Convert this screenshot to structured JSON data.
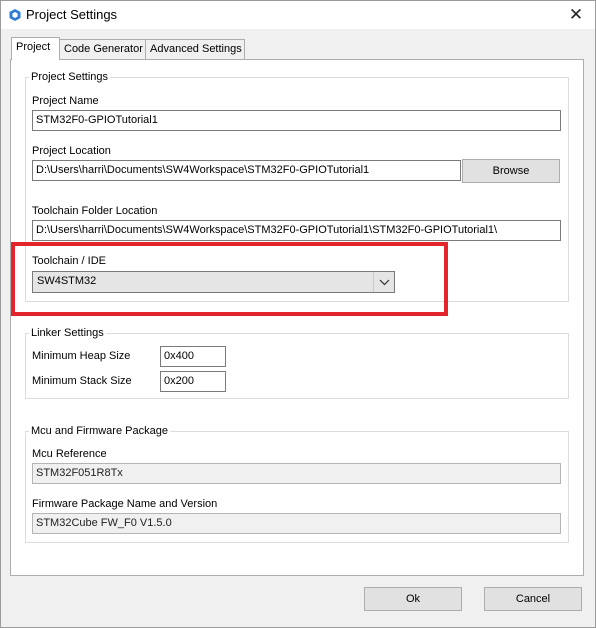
{
  "window": {
    "title": "Project Settings",
    "close_glyph": "✕"
  },
  "tabs": [
    {
      "label": "Project"
    },
    {
      "label": "Code Generator"
    },
    {
      "label": "Advanced Settings"
    }
  ],
  "project_settings": {
    "legend": "Project Settings",
    "project_name": {
      "label": "Project Name",
      "value": "STM32F0-GPIOTutorial1"
    },
    "project_location": {
      "label": "Project Location",
      "value": "D:\\Users\\harri\\Documents\\SW4Workspace\\STM32F0-GPIOTutorial1",
      "browse_label": "Browse"
    },
    "toolchain_folder": {
      "label": "Toolchain Folder Location",
      "value": "D:\\Users\\harri\\Documents\\SW4Workspace\\STM32F0-GPIOTutorial1\\STM32F0-GPIOTutorial1\\"
    },
    "toolchain_ide": {
      "label": "Toolchain / IDE",
      "selected": "SW4STM32"
    }
  },
  "linker_settings": {
    "legend": "Linker Settings",
    "heap": {
      "label": "Minimum Heap Size",
      "value": "0x400"
    },
    "stack": {
      "label": "Minimum Stack Size",
      "value": "0x200"
    }
  },
  "mcu_package": {
    "legend": "Mcu and Firmware Package",
    "mcu_reference": {
      "label": "Mcu Reference",
      "value": "STM32F051R8Tx"
    },
    "firmware": {
      "label": "Firmware Package Name and Version",
      "value": "STM32Cube FW_F0 V1.5.0"
    }
  },
  "footer": {
    "ok_label": "Ok",
    "cancel_label": "Cancel"
  },
  "colors": {
    "highlight": "#e3242b",
    "icon_blue": "#2d7dd2"
  }
}
